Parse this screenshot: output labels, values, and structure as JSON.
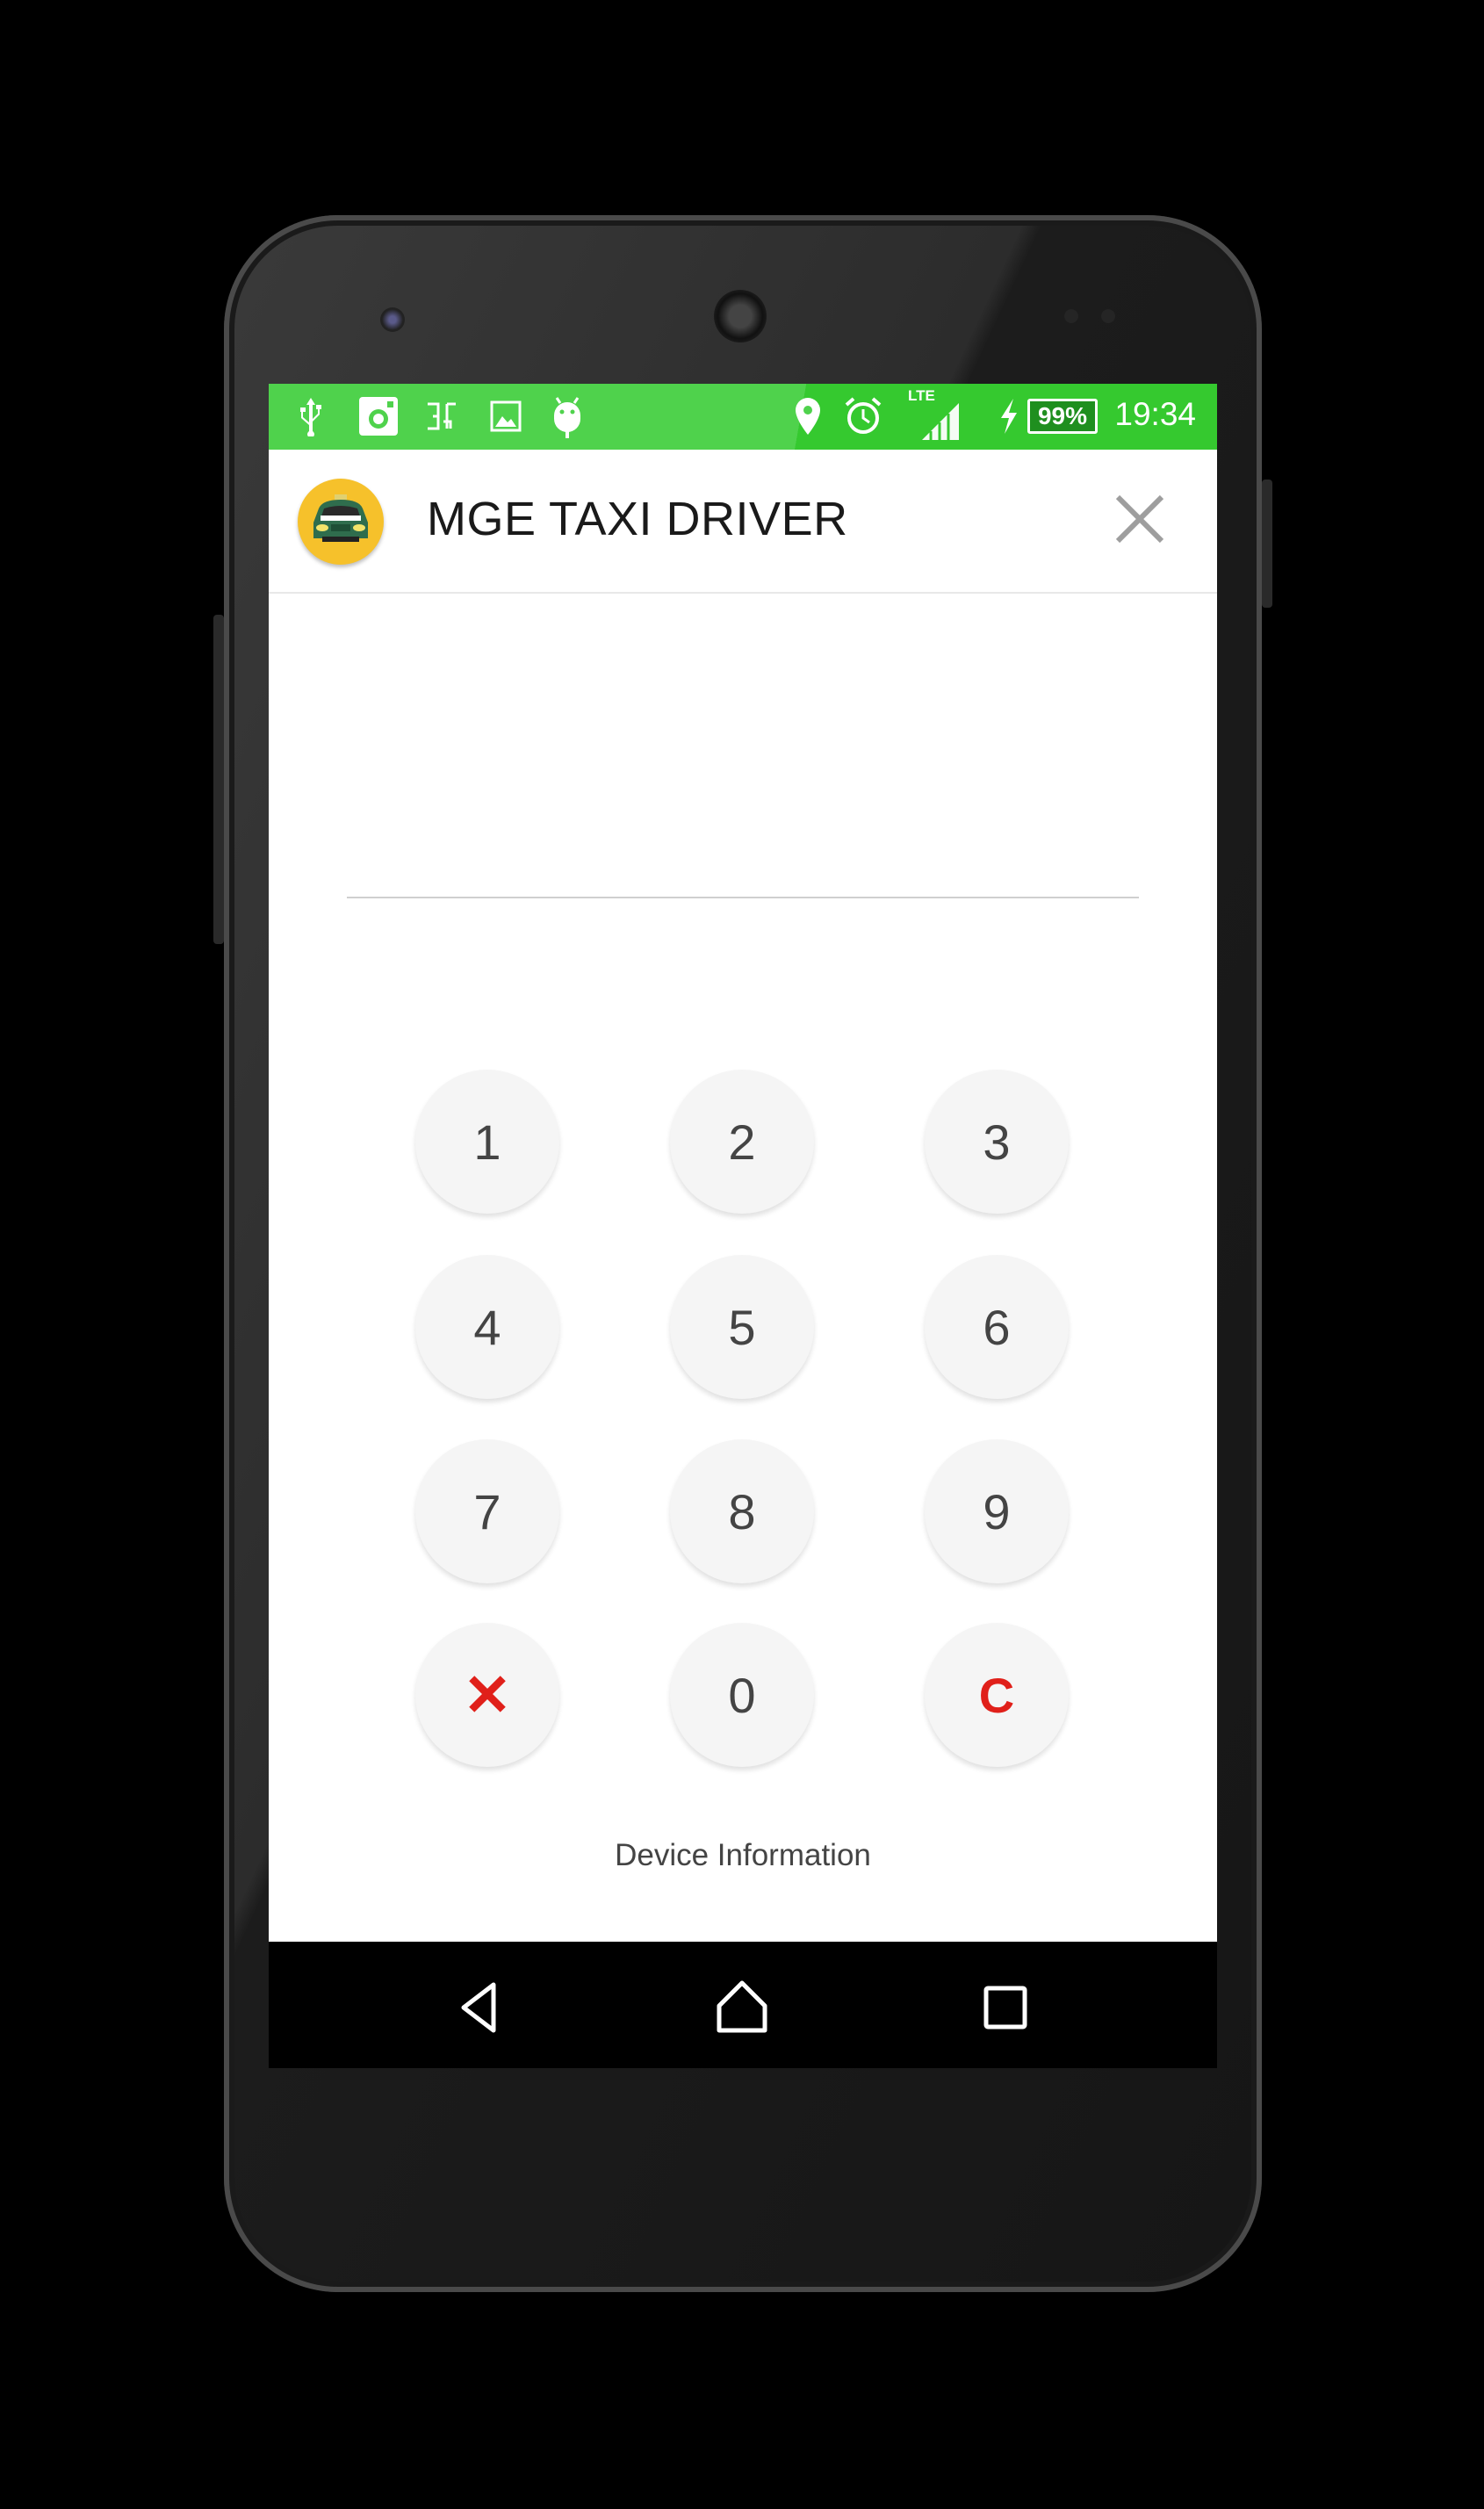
{
  "status_bar": {
    "left_icons": [
      "usb-icon",
      "instagram-icon",
      "text-cursor-icon",
      "image-icon",
      "android-icon"
    ],
    "right_icons": [
      "location-pin-icon",
      "alarm-icon",
      "lte-signal-icon",
      "charging-icon"
    ],
    "network_label": "LTE",
    "battery": "99%",
    "time": "19:34",
    "color_left": "#4fd24c",
    "color_right": "#35c92f"
  },
  "header": {
    "title": "MGE TAXI DRIVER",
    "logo_icon": "taxi-icon",
    "close_icon": "close-icon"
  },
  "pin_input": {
    "value": ""
  },
  "keypad": {
    "keys": [
      "1",
      "2",
      "3",
      "4",
      "5",
      "6",
      "7",
      "8",
      "9",
      "✕",
      "0",
      "C"
    ],
    "accent_color": "#e0201a"
  },
  "footer": {
    "device_info_label": "Device Information"
  },
  "nav_bar": {
    "icons": [
      "back-icon",
      "home-icon",
      "recents-icon"
    ]
  }
}
